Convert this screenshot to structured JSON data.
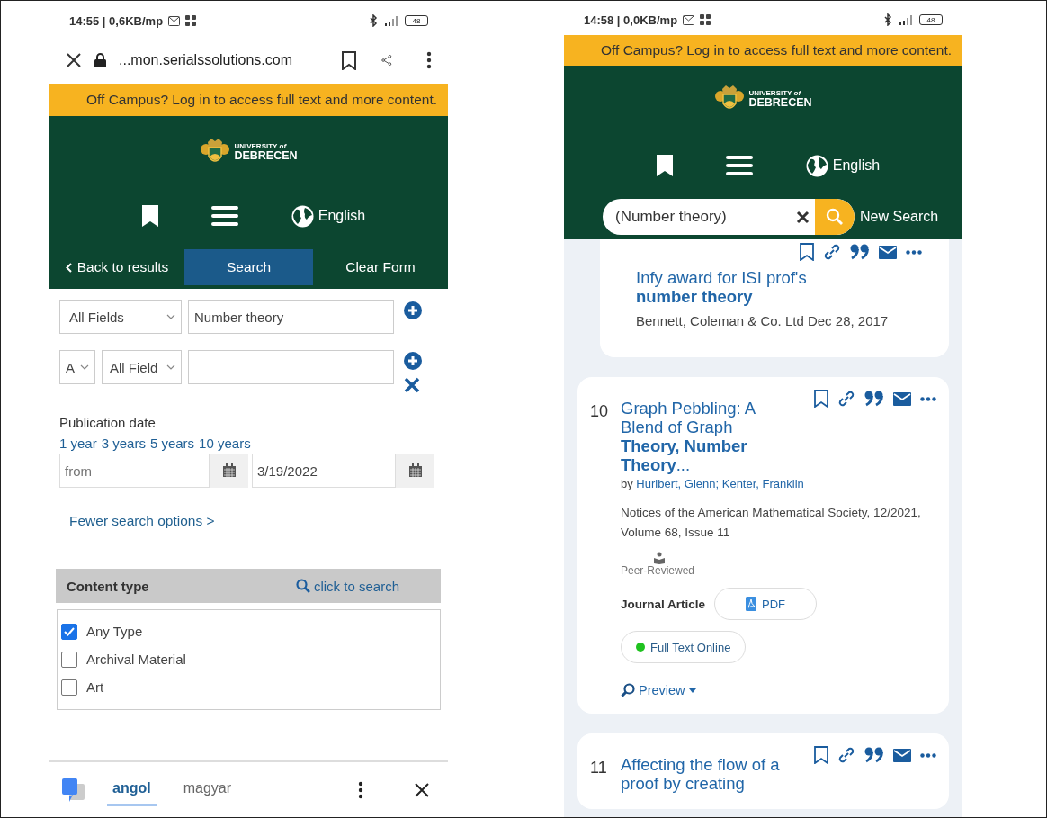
{
  "left_phone": {
    "status_bar": {
      "text": "14:55 | 0,6KB/mp",
      "battery": "48"
    },
    "browser_bar": {
      "url": "...mon.serialssolutions.com"
    },
    "banner": "Off Campus? Log in to access full text and more content.",
    "header": {
      "logo": "UNIVERSITY *of*",
      "logo_name": "DEBRECEN",
      "language": "English"
    },
    "nav": [
      {
        "label": "Back to results",
        "selected": false,
        "kind": "back"
      },
      {
        "label": "Search",
        "selected": true,
        "kind": "tab"
      },
      {
        "label": "Clear Form",
        "selected": false,
        "kind": "tab"
      }
    ],
    "search_rows": [
      {
        "field": "All Fields",
        "value": "Number theory",
        "removable": false
      },
      {
        "operator": "A",
        "field": "All Field",
        "removable": true
      }
    ],
    "publication_date": {
      "label": "Publication date",
      "ranges": [
        "1 year",
        "3 years",
        "5 years",
        "10 years"
      ],
      "from_placeholder": "from",
      "to_value": "3/19/2022"
    },
    "fewer_options": "Fewer search options >",
    "content_type": {
      "title": "Content type",
      "search_link": "click to search",
      "options": [
        {
          "label": "Any Type",
          "checked": true
        },
        {
          "label": "Archival Material",
          "checked": false
        },
        {
          "label": "Art",
          "checked": false
        }
      ]
    },
    "translate_bar": {
      "languages": [
        {
          "label": "angol",
          "selected": true
        },
        {
          "label": "magyar",
          "selected": false
        }
      ]
    }
  },
  "right_phone": {
    "status_bar": {
      "text": "14:58 | 0,0KB/mp",
      "battery": "48"
    },
    "banner": "Off Campus? Log in to access full text and more content.",
    "header": {
      "logo": "UNIVERSITY *of*",
      "logo_name": "DEBRECEN",
      "language": "English"
    },
    "search": {
      "value": "(Number theory)",
      "new_search": "New Search"
    },
    "results": [
      {
        "title": "Infy award for ISI prof's **number theory**",
        "meta": "Bennett, Coleman & Co. Ltd  Dec 28, 2017"
      },
      {
        "number": "10",
        "title": "Graph Pebbling: A Blend of Graph **Theory, Number Theory**...",
        "by": "by",
        "authors": "Hurlbert, Glenn; Kenter, Franklin",
        "source": "Notices of the American Mathematical Society, 12/2021, Volume 68, Issue 11",
        "peer_reviewed": "Peer-Reviewed",
        "type": "Journal Article",
        "pdf": "PDF",
        "availability": {
          "label": "Full Text Online",
          "color": "#1fc21f"
        },
        "preview": "Preview"
      },
      {
        "number": "11",
        "title": "Affecting the flow of a proof by creating"
      }
    ]
  }
}
